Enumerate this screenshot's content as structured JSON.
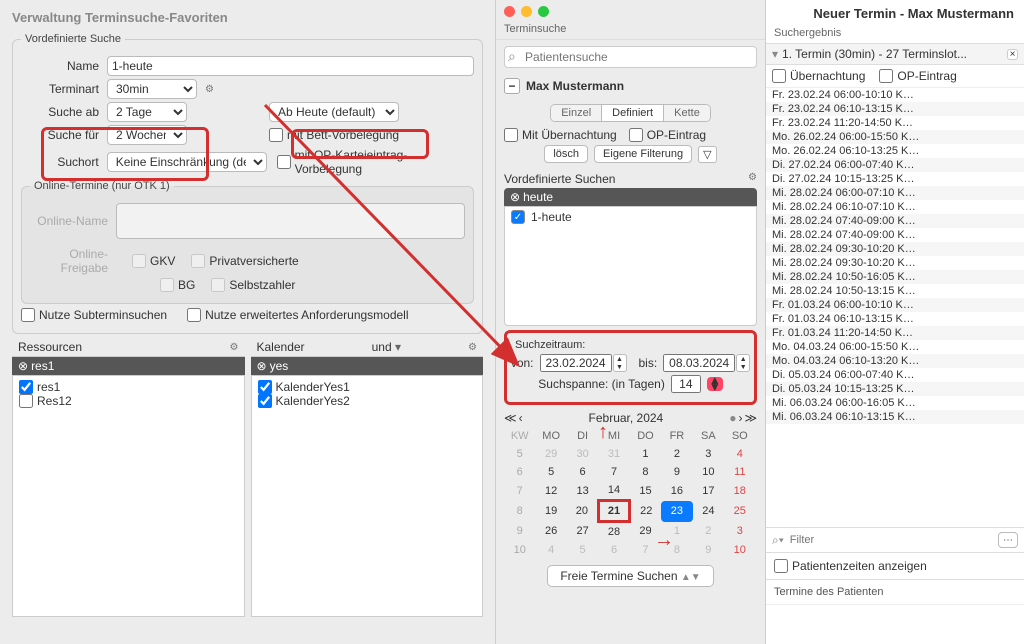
{
  "left": {
    "title": "Verwaltung Terminsuche-Favoriten",
    "groupTitle": "Vordefinierte Suche",
    "nameLabel": "Name",
    "nameValue": "1-heute",
    "terminartLabel": "Terminart",
    "terminartValue": "30min",
    "sucheAbLabel": "Suche ab",
    "sucheAbValue": "2 Tage",
    "abHeuteValue": "Ab Heute (default)",
    "sucheFuerLabel": "Suche für",
    "sucheFuerValue": "2 Wochen",
    "bettLabel": "mit Bett-Vorbelegung",
    "suchortLabel": "Suchort",
    "suchortValue": "Keine Einschränkung (default)",
    "opLabel": "mit OP-Karteieintrag-Vorbelegung",
    "onlineGroup": "Online-Termine (nur OTK 1)",
    "onlineName": "Online-Name",
    "onlineFreigabe": "Online-Freigabe",
    "gkv": "GKV",
    "privat": "Privatversicherte",
    "bg": "BG",
    "selbst": "Selbstzahler",
    "subtermin": "Nutze Subterminsuchen",
    "erwModell": "Nutze erweitertes Anforderungsmodell",
    "resHeader": "Ressourcen",
    "resDark": "res1",
    "resItems": [
      "res1",
      "Res12"
    ],
    "kalHeader": "Kalender",
    "kalUnd": "und",
    "kalDark": "yes",
    "kalItems": [
      "KalenderYes1",
      "KalenderYes2"
    ]
  },
  "mid": {
    "title": "Terminsuche",
    "searchPlaceholder": "Patientensuche",
    "patient": "Max Mustermann",
    "segEinzel": "Einzel",
    "segDefiniert": "Definiert",
    "segKette": "Kette",
    "mitUeber": "Mit Übernachtung",
    "opEintrag": "OP-Eintrag",
    "loesch": "lösch",
    "eigFilter": "Eigene Filterung",
    "vordefHeader": "Vordefinierte Suchen",
    "vordefDark": "heute",
    "vordefItem": "1-heute",
    "suchzTitle": "Suchzeitraum:",
    "vonLabel": "von:",
    "vonValue": "23.02.2024",
    "bisLabel": "bis:",
    "bisValue": "08.03.2024",
    "spanneLabel": "Suchspanne: (in Tagen)",
    "spanneValue": "14",
    "calMonth": "Februar, 2024",
    "calDays": [
      "KW",
      "MO",
      "DI",
      "MI",
      "DO",
      "FR",
      "SA",
      "SO"
    ],
    "calRows": [
      [
        "5",
        "29",
        "30",
        "31",
        "1",
        "2",
        "3",
        "4"
      ],
      [
        "6",
        "5",
        "6",
        "7",
        "8",
        "9",
        "10",
        "11"
      ],
      [
        "7",
        "12",
        "13",
        "14",
        "15",
        "16",
        "17",
        "18"
      ],
      [
        "8",
        "19",
        "20",
        "21",
        "22",
        "23",
        "24",
        "25"
      ],
      [
        "9",
        "26",
        "27",
        "28",
        "29",
        "1",
        "2",
        "3"
      ],
      [
        "10",
        "4",
        "5",
        "6",
        "7",
        "8",
        "9",
        "10"
      ]
    ],
    "suchenBtn": "Freie Termine Suchen"
  },
  "right": {
    "title": "Neuer Termin - Max Mustermann",
    "sub": "Suchergebnis",
    "resultHdr": "1. Termin (30min) - 27 Terminslot...",
    "ueber": "Übernachtung",
    "opE": "OP-Eintrag",
    "rows": [
      "Fr.  23.02.24  06:00-10:10  K…",
      "Fr.  23.02.24  06:10-13:15  K…",
      "Fr.  23.02.24  11:20-14:50  K…",
      "Mo.  26.02.24  06:00-15:50  K…",
      "Mo.  26.02.24  06:10-13:25  K…",
      "Di.  27.02.24  06:00-07:40  K…",
      "Di.  27.02.24  10:15-13:25  K…",
      "Mi.  28.02.24  06:00-07:10  K…",
      "Mi.  28.02.24  06:10-07:10  K…",
      "Mi.  28.02.24  07:40-09:00  K…",
      "Mi.  28.02.24  07:40-09:00  K…",
      "Mi.  28.02.24  09:30-10:20  K…",
      "Mi.  28.02.24  09:30-10:20  K…",
      "Mi.  28.02.24  10:50-16:05  K…",
      "Mi.  28.02.24  10:50-13:15  K…",
      "Fr.  01.03.24  06:00-10:10  K…",
      "Fr.  01.03.24  06:10-13:15  K…",
      "Fr.  01.03.24  11:20-14:50  K…",
      "Mo.  04.03.24  06:00-15:50  K…",
      "Mo.  04.03.24  06:10-13:20  K…",
      "Di.  05.03.24  06:00-07:40  K…",
      "Di.  05.03.24  10:15-13:25  K…",
      "Mi.  06.03.24  06:00-16:05  K…",
      "Mi.  06.03.24  06:10-13:15  K…"
    ],
    "filterPlaceholder": "Filter",
    "patZeiten": "Patientenzeiten anzeigen",
    "terminePat": "Termine des Patienten"
  }
}
